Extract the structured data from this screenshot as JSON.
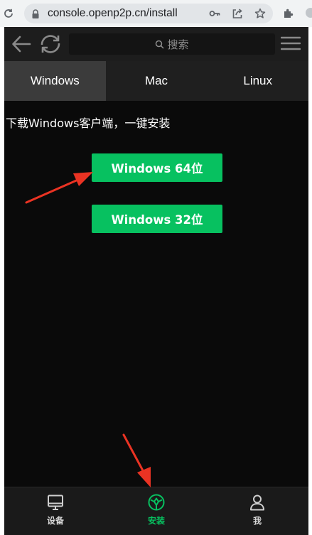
{
  "browser": {
    "url": "console.openp2p.cn/install",
    "icons": [
      "reload-icon",
      "lock-icon",
      "key-icon",
      "share-icon",
      "star-icon",
      "extensions-icon"
    ]
  },
  "app": {
    "header": {
      "search_placeholder": "搜索",
      "icons": [
        "back-arrow-icon",
        "refresh-icon",
        "search-icon",
        "menu-icon"
      ]
    },
    "tabs": [
      {
        "label": "Windows",
        "active": true
      },
      {
        "label": "Mac",
        "active": false
      },
      {
        "label": "Linux",
        "active": false
      }
    ],
    "intro": "下载Windows客户端，一键安装",
    "buttons": {
      "win64": "Windows 64位",
      "win32": "Windows 32位"
    },
    "bottom_nav": [
      {
        "label": "设备",
        "icon": "monitor-icon",
        "active": false
      },
      {
        "label": "安装",
        "icon": "install-icon",
        "active": true
      },
      {
        "label": "我",
        "icon": "user-icon",
        "active": false
      }
    ]
  },
  "colors": {
    "accent": "#07c160",
    "background": "#0a0a0a",
    "annotation": "#ea3323"
  }
}
